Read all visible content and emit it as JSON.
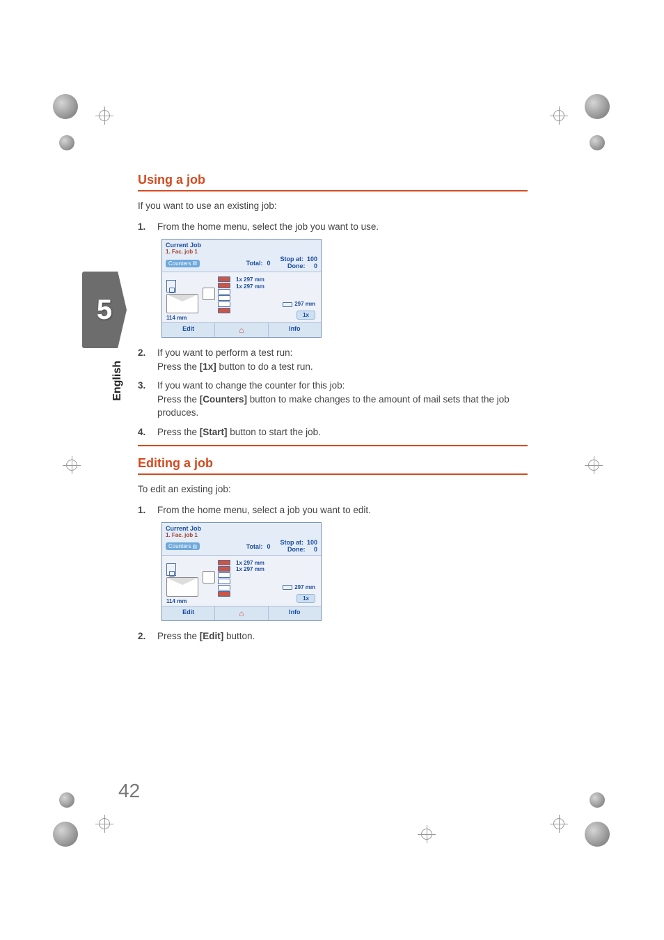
{
  "page_number": "42",
  "chapter_badge": "5",
  "language_tab": "English",
  "section1": {
    "title": "Using a job",
    "intro": "If you want to use an existing job:",
    "steps": [
      {
        "n": "1.",
        "text": "From the home menu, select the job you want to use."
      },
      {
        "n": "2.",
        "line1": "If you want to perform a test run:",
        "line2a": "Press the ",
        "btn": "[1x]",
        "line2b": " button to do a test run."
      },
      {
        "n": "3.",
        "line1": "If you want to change the counter for this job:",
        "line2a": "Press the ",
        "btn": "[Counters]",
        "line2b": " button to make changes to the amount of mail sets that the job produces."
      },
      {
        "n": "4.",
        "text_a": "Press the ",
        "btn": "[Start]",
        "text_b": " button to start the job."
      }
    ]
  },
  "section2": {
    "title": "Editing a job",
    "intro": "To edit an existing job:",
    "steps": [
      {
        "n": "1.",
        "text": "From the home menu, select a job you want to edit."
      },
      {
        "n": "2.",
        "text_a": "Press the ",
        "btn": "[Edit]",
        "text_b": " button."
      }
    ]
  },
  "panel": {
    "title": "Current Job",
    "subtitle": "1. Fac. job 1",
    "counters_btn": "Counters",
    "total_label": "Total:",
    "total_value": "0",
    "stop_at_label": "Stop at:",
    "stop_at_value": "100",
    "done_label": "Done:",
    "done_value": "0",
    "tray1": "1x   297 mm",
    "tray2": "1x   297 mm",
    "out_size": "297 mm",
    "env_size": "114 mm",
    "b1x": "1x",
    "edit": "Edit",
    "home_icon": "⌂",
    "info": "Info"
  }
}
